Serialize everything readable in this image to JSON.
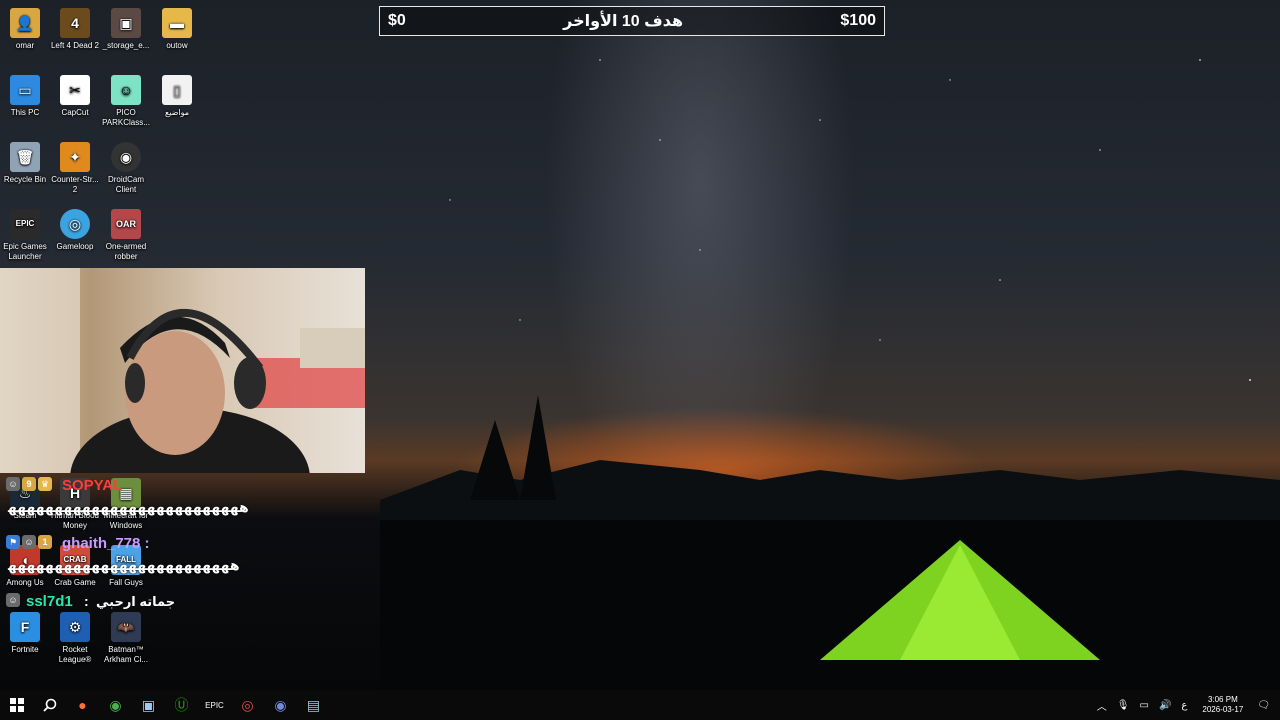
{
  "desktop_icons": [
    {
      "label": "omar",
      "color": "#d9a741",
      "glyph": "👤"
    },
    {
      "label": "Left 4 Dead 2",
      "color": "#6b4a1e",
      "glyph": "4"
    },
    {
      "label": "_storage_e...",
      "color": "#5b4a44",
      "glyph": "▣"
    },
    {
      "label": "outow",
      "color": "#e6b84a",
      "glyph": "▬"
    },
    {
      "label": "This PC",
      "color": "#2d8ae0",
      "glyph": "▭"
    },
    {
      "label": "CapCut",
      "color": "#ffffff",
      "glyph": "✂"
    },
    {
      "label": "PICO PARKClass...",
      "color": "#7de3c5",
      "glyph": "☺"
    },
    {
      "label": "مواضيع",
      "color": "#f2f2f2",
      "glyph": "▯"
    },
    {
      "label": "Recycle Bin",
      "color": "#8fa3b5",
      "glyph": "🗑"
    },
    {
      "label": "Counter-Str... 2",
      "color": "#e08a1e",
      "glyph": "✦"
    },
    {
      "label": "DroidCam Client",
      "color": "#333333",
      "glyph": "◉"
    },
    {
      "label": "Epic Games Launcher",
      "color": "#2a2a2a",
      "glyph": "EPIC"
    },
    {
      "label": "Gameloop",
      "color": "#3aa3e0",
      "glyph": "◎"
    },
    {
      "label": "One-armed robber",
      "color": "#b3474a",
      "glyph": "OAR"
    },
    {
      "label": "Steam",
      "color": "#1b2838",
      "glyph": "♨"
    },
    {
      "label": "Hitman Blood Money",
      "color": "#3a3a3a",
      "glyph": "H"
    },
    {
      "label": "Minecraft for Windows",
      "color": "#6c8f3d",
      "glyph": "▦"
    },
    {
      "label": "Among Us",
      "color": "#c0392b",
      "glyph": "◖"
    },
    {
      "label": "Crab Game",
      "color": "#d24a3a",
      "glyph": "CRAB"
    },
    {
      "label": "Fall Guys",
      "color": "#4aa3e8",
      "glyph": "FALL"
    },
    {
      "label": "Fortnite",
      "color": "#2a8fe0",
      "glyph": "F"
    },
    {
      "label": "Rocket League®",
      "color": "#1e5fb3",
      "glyph": "⚙"
    },
    {
      "label": "Batman™ Arkham Ci...",
      "color": "#2f3b52",
      "glyph": "🦇"
    }
  ],
  "donation_bar": {
    "left_amount": "$0",
    "title": "هدف 10 الأواخر",
    "right_amount": "$100"
  },
  "chat": [
    {
      "username": "SOPYAL",
      "username_color": "#ff3b3b",
      "separator": "",
      "message": "ﻫﻬﻬﻬﻬﻬﻬﻬﻬﻬﻬﻬﻬﻬﻬﻬﻬﻬﻬﻬﻬﻬﻬﻬﻬﻬ"
    },
    {
      "username": "ghaith_778",
      "username_color": "#c89bff",
      "separator": ":",
      "message": "ﻫﻬﻬﻬﻬﻬﻬﻬﻬﻬﻬﻬﻬﻬﻬﻬﻬﻬﻬﻬﻬﻬﻬﻬﻬ"
    },
    {
      "username": "ssl7d1",
      "username_color": "#2ee6a8",
      "separator": ":",
      "message": "جماته ارحبي"
    }
  ],
  "taskbar": {
    "apps": [
      "start-icon",
      "search-icon",
      "firefox-icon",
      "chrome-icon",
      "store-icon",
      "upwork-icon",
      "epic-icon",
      "obs-icon",
      "discord-icon",
      "notepad-icon"
    ],
    "tray_language": "ع",
    "time": "3:06 PM",
    "date": "2026-03-17"
  }
}
